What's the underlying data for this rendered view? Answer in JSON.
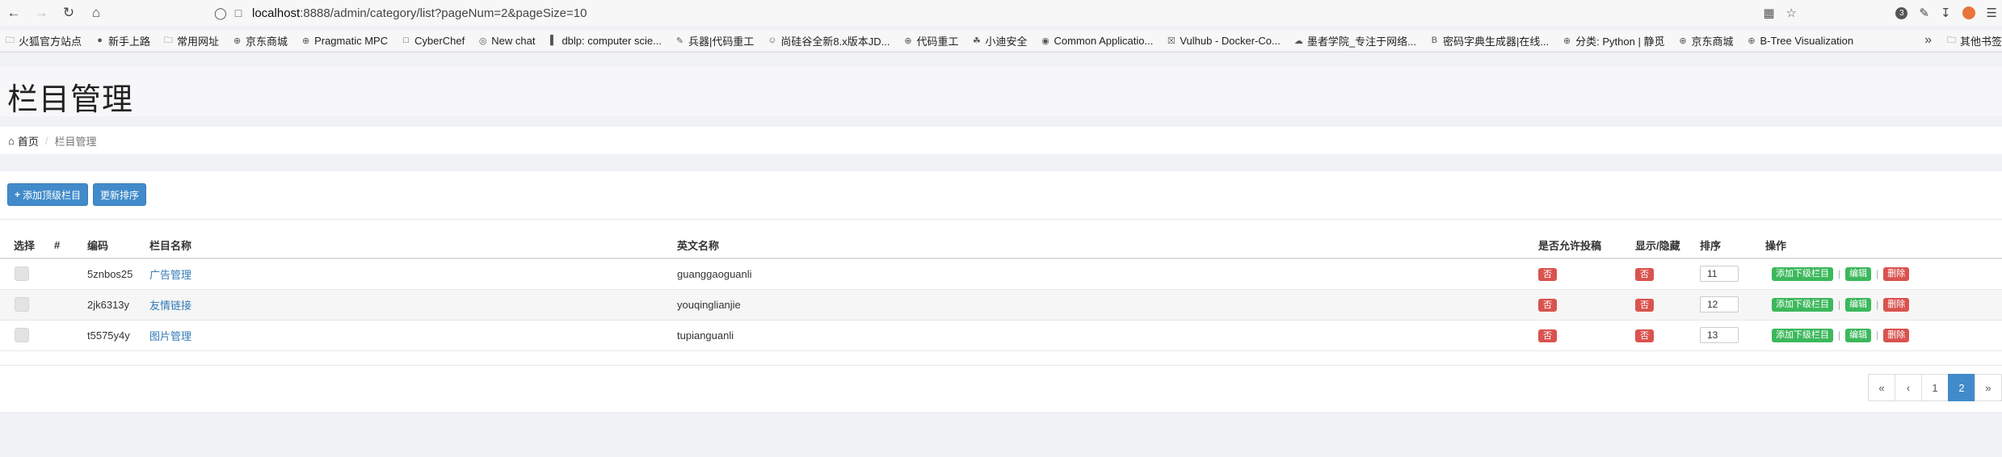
{
  "browser": {
    "url_host": "localhost",
    "url_rest": ":8888/admin/category/list?pageNum=2&pageSize=10",
    "tab_count": "3",
    "bookmarks": [
      {
        "label": "火狐官方站点",
        "icon": "folder-icon"
      },
      {
        "label": "新手上路",
        "icon": "firefox-icon"
      },
      {
        "label": "常用网址",
        "icon": "folder-icon"
      },
      {
        "label": "京东商城",
        "icon": "globe-icon"
      },
      {
        "label": "Pragmatic MPC",
        "icon": "globe-icon"
      },
      {
        "label": "CyberChef",
        "icon": "page-icon"
      },
      {
        "label": "New chat",
        "icon": "chat-icon"
      },
      {
        "label": "dblp: computer scie...",
        "icon": "dblp-icon"
      },
      {
        "label": "兵器|代码重工",
        "icon": "pen-icon"
      },
      {
        "label": "尚硅谷全新8.x版本JD...",
        "icon": "person-icon"
      },
      {
        "label": "代码重工",
        "icon": "globe-icon"
      },
      {
        "label": "小迪安全",
        "icon": "leaf-icon"
      },
      {
        "label": "Common Applicatio...",
        "icon": "app-icon"
      },
      {
        "label": "Vulhub - Docker-Co...",
        "icon": "vulhub-icon"
      },
      {
        "label": "墨者学院_专注于网络...",
        "icon": "cloud-icon"
      },
      {
        "label": "密码字典生成器|在线...",
        "icon": "b-icon"
      },
      {
        "label": "分类: Python | 静觅",
        "icon": "globe-icon"
      },
      {
        "label": "京东商城",
        "icon": "globe-icon"
      },
      {
        "label": "B-Tree Visualization",
        "icon": "globe-icon"
      }
    ],
    "other_bookmarks": "其他书签"
  },
  "page": {
    "title": "栏目管理",
    "breadcrumb_home": "首页",
    "breadcrumb_current": "栏目管理"
  },
  "toolbar": {
    "add_top_label": "添加顶级栏目",
    "update_sort_label": "更新排序"
  },
  "table": {
    "headers": {
      "select": "选择",
      "index": "#",
      "code": "编码",
      "name": "栏目名称",
      "en_name": "英文名称",
      "allow_post": "是否允许投稿",
      "show_hide": "显示/隐藏",
      "sort": "排序",
      "ops": "操作"
    },
    "rows": [
      {
        "code": "5znbos25",
        "name": "广告管理",
        "en_name": "guanggaoguanli",
        "allow_post": "否",
        "show": "否",
        "sort": "11"
      },
      {
        "code": "2jk6313y",
        "name": "友情链接",
        "en_name": "youqinglianjie",
        "allow_post": "否",
        "show": "否",
        "sort": "12"
      },
      {
        "code": "t5575y4y",
        "name": "图片管理",
        "en_name": "tupianguanli",
        "allow_post": "否",
        "show": "否",
        "sort": "13"
      }
    ],
    "ops": {
      "add_sub": "添加下级栏目",
      "edit": "编辑",
      "delete": "删除",
      "sep": "|"
    }
  },
  "pagination": {
    "first": "«",
    "prev": "‹",
    "pages": [
      "1",
      "2"
    ],
    "current": "2",
    "next": "»"
  },
  "colors": {
    "primary": "#428bca",
    "danger": "#d9534f",
    "success": "#3cb85c",
    "link": "#337ab7"
  }
}
